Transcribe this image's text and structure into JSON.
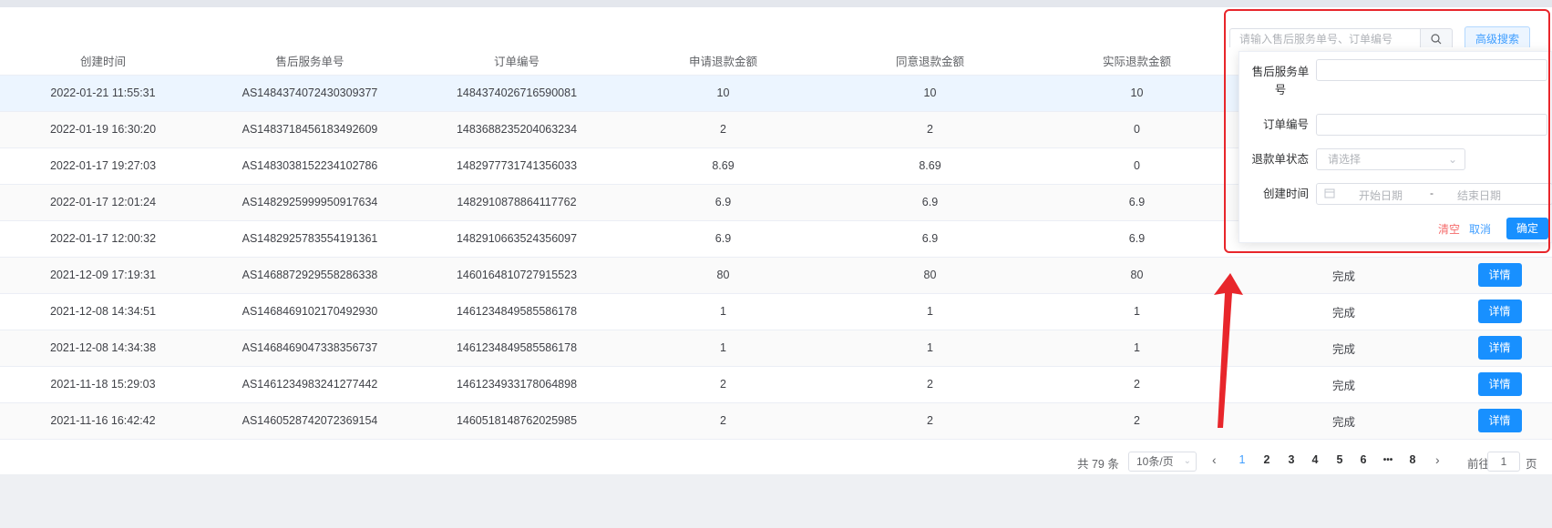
{
  "search": {
    "placeholder": "请输入售后服务单号、订单编号",
    "advanced_label": "高级搜索"
  },
  "table": {
    "columns": [
      "创建时间",
      "售后服务单号",
      "订单编号",
      "申请退款金额",
      "同意退款金额",
      "实际退款金额",
      "",
      ""
    ],
    "rows": [
      {
        "created": "2022-01-21 11:55:31",
        "service_no": "AS1484374072430309377",
        "order_no": "1484374026716590081",
        "apply": "10",
        "agree": "10",
        "actual": "10",
        "status": "",
        "action": ""
      },
      {
        "created": "2022-01-19 16:30:20",
        "service_no": "AS1483718456183492609",
        "order_no": "1483688235204063234",
        "apply": "2",
        "agree": "2",
        "actual": "0",
        "status": "",
        "action": ""
      },
      {
        "created": "2022-01-17 19:27:03",
        "service_no": "AS1483038152234102786",
        "order_no": "1482977731741356033",
        "apply": "8.69",
        "agree": "8.69",
        "actual": "0",
        "status": "",
        "action": ""
      },
      {
        "created": "2022-01-17 12:01:24",
        "service_no": "AS1482925999950917634",
        "order_no": "1482910878864117762",
        "apply": "6.9",
        "agree": "6.9",
        "actual": "6.9",
        "status": "",
        "action": ""
      },
      {
        "created": "2022-01-17 12:00:32",
        "service_no": "AS1482925783554191361",
        "order_no": "1482910663524356097",
        "apply": "6.9",
        "agree": "6.9",
        "actual": "6.9",
        "status": "",
        "action": ""
      },
      {
        "created": "2021-12-09 17:19:31",
        "service_no": "AS1468872929558286338",
        "order_no": "1460164810727915523",
        "apply": "80",
        "agree": "80",
        "actual": "80",
        "status": "完成",
        "action": "详情"
      },
      {
        "created": "2021-12-08 14:34:51",
        "service_no": "AS1468469102170492930",
        "order_no": "1461234849585586178",
        "apply": "1",
        "agree": "1",
        "actual": "1",
        "status": "完成",
        "action": "详情"
      },
      {
        "created": "2021-12-08 14:34:38",
        "service_no": "AS1468469047338356737",
        "order_no": "1461234849585586178",
        "apply": "1",
        "agree": "1",
        "actual": "1",
        "status": "完成",
        "action": "详情"
      },
      {
        "created": "2021-11-18 15:29:03",
        "service_no": "AS1461234983241277442",
        "order_no": "1461234933178064898",
        "apply": "2",
        "agree": "2",
        "actual": "2",
        "status": "完成",
        "action": "详情"
      },
      {
        "created": "2021-11-16 16:42:42",
        "service_no": "AS1460528742072369154",
        "order_no": "1460518148762025985",
        "apply": "2",
        "agree": "2",
        "actual": "2",
        "status": "完成",
        "action": "详情"
      }
    ]
  },
  "pagination": {
    "total_text": "共 79 条",
    "page_size": "10条/页",
    "pages": [
      "1",
      "2",
      "3",
      "4",
      "5",
      "6"
    ],
    "ellipsis": "•••",
    "last_page": "8",
    "current": "1",
    "goto_prefix": "前往",
    "goto_value": "1",
    "goto_suffix": "页"
  },
  "advanced": {
    "service_no_label": "售后服务单号",
    "order_no_label": "订单编号",
    "status_label": "退款单状态",
    "status_placeholder": "请选择",
    "created_label": "创建时间",
    "start_placeholder": "开始日期",
    "date_separator": "-",
    "end_placeholder": "结束日期",
    "clear_label": "清空",
    "cancel_label": "取消",
    "ok_label": "确定"
  },
  "colors": {
    "primary": "#1890ff",
    "danger": "#f56c6c",
    "annotation": "#e8262b"
  }
}
